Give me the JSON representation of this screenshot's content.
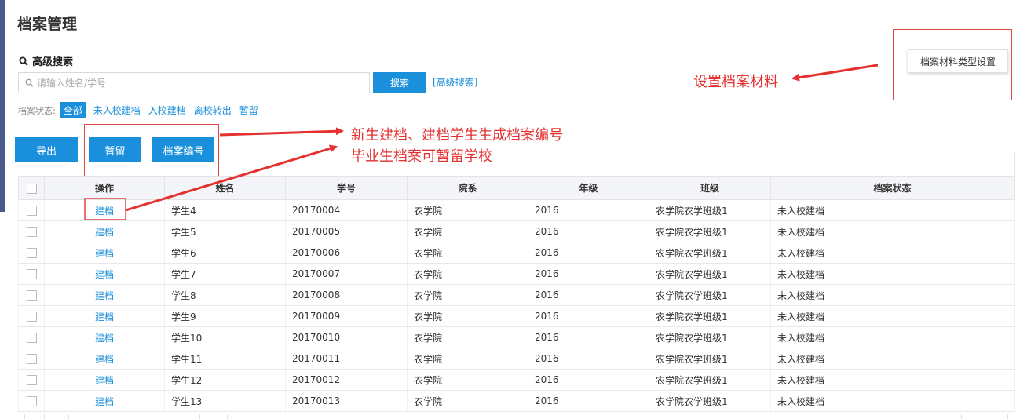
{
  "page": {
    "title": "档案管理"
  },
  "search": {
    "section_label": "高级搜索",
    "placeholder": "请输入姓名/学号",
    "button_label": "搜索",
    "advanced_link": "[高级搜索]"
  },
  "status_filter": {
    "label": "档案状态:",
    "items": [
      "全部",
      "未入校建档",
      "入校建档",
      "离校转出",
      "暂留"
    ],
    "active": "全部"
  },
  "toolbar": {
    "export_label": "导出",
    "hold_label": "暂留",
    "number_label": "档案编号"
  },
  "settings": {
    "label": "档案材料类型设置"
  },
  "annotations": {
    "settings_note": "设置档案材料",
    "number_note": "新生建档、建档学生生成档案编号",
    "hold_note": "毕业生档案可暂留学校"
  },
  "table": {
    "headers": [
      "操作",
      "姓名",
      "学号",
      "院系",
      "年级",
      "班级",
      "档案状态"
    ],
    "rows": [
      {
        "op": "建档",
        "name": "学生4",
        "id": "20170004",
        "dept": "农学院",
        "grade": "2016",
        "class": "农学院农学班级1",
        "status": "未入校建档"
      },
      {
        "op": "建档",
        "name": "学生5",
        "id": "20170005",
        "dept": "农学院",
        "grade": "2016",
        "class": "农学院农学班级1",
        "status": "未入校建档"
      },
      {
        "op": "建档",
        "name": "学生6",
        "id": "20170006",
        "dept": "农学院",
        "grade": "2016",
        "class": "农学院农学班级1",
        "status": "未入校建档"
      },
      {
        "op": "建档",
        "name": "学生7",
        "id": "20170007",
        "dept": "农学院",
        "grade": "2016",
        "class": "农学院农学班级1",
        "status": "未入校建档"
      },
      {
        "op": "建档",
        "name": "学生8",
        "id": "20170008",
        "dept": "农学院",
        "grade": "2016",
        "class": "农学院农学班级1",
        "status": "未入校建档"
      },
      {
        "op": "建档",
        "name": "学生9",
        "id": "20170009",
        "dept": "农学院",
        "grade": "2016",
        "class": "农学院农学班级1",
        "status": "未入校建档"
      },
      {
        "op": "建档",
        "name": "学生10",
        "id": "20170010",
        "dept": "农学院",
        "grade": "2016",
        "class": "农学院农学班级1",
        "status": "未入校建档"
      },
      {
        "op": "建档",
        "name": "学生11",
        "id": "20170011",
        "dept": "农学院",
        "grade": "2016",
        "class": "农学院农学班级1",
        "status": "未入校建档"
      },
      {
        "op": "建档",
        "name": "学生12",
        "id": "20170012",
        "dept": "农学院",
        "grade": "2016",
        "class": "农学院农学班级1",
        "status": "未入校建档"
      },
      {
        "op": "建档",
        "name": "学生13",
        "id": "20170013",
        "dept": "农学院",
        "grade": "2016",
        "class": "农学院农学班级1",
        "status": "未入校建档"
      }
    ]
  },
  "colors": {
    "primary": "#1a8fdb",
    "annotation": "#e53030",
    "sidebar": "#4a5a8c"
  }
}
